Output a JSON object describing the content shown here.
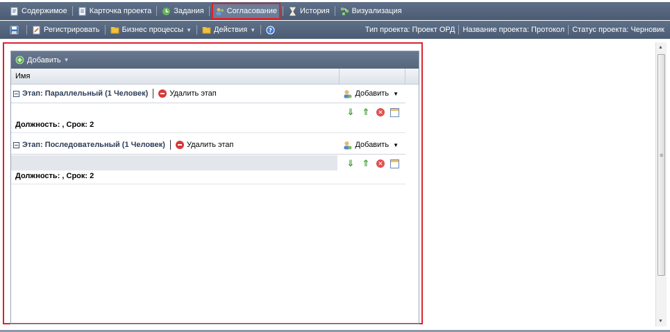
{
  "nav": {
    "items": [
      {
        "label": "Содержимое",
        "icon": "document-icon"
      },
      {
        "label": "Карточка проекта",
        "icon": "card-icon"
      },
      {
        "label": "Задания",
        "icon": "tasks-icon"
      },
      {
        "label": "Согласование",
        "icon": "approval-icon"
      },
      {
        "label": "История",
        "icon": "hourglass-icon"
      },
      {
        "label": "Визуализация",
        "icon": "diagram-icon"
      }
    ]
  },
  "toolbar": {
    "register_label": "Регистрировать",
    "business_label": "Бизнес процессы",
    "actions_label": "Действия"
  },
  "status": {
    "type": "Тип проекта: Проект ОРД",
    "name": "Название проекта: Протокол",
    "state": "Статус проекта: Черновик"
  },
  "grid": {
    "add_label": "Добавить",
    "column_name": "Имя",
    "stages": [
      {
        "title": "Этап: Параллельный (1 Человек)",
        "delete_label": "Удалить этап",
        "add_label": "Добавить",
        "row_text": "Должность: , Срок: 2"
      },
      {
        "title": "Этап: Последовательный (1 Человек)",
        "delete_label": "Удалить этап",
        "add_label": "Добавить",
        "row_text": "Должность: , Срок: 2"
      }
    ]
  },
  "colors": {
    "bar": "#54657c",
    "highlight": "#d9232e",
    "stage_title": "#2c3c58"
  }
}
